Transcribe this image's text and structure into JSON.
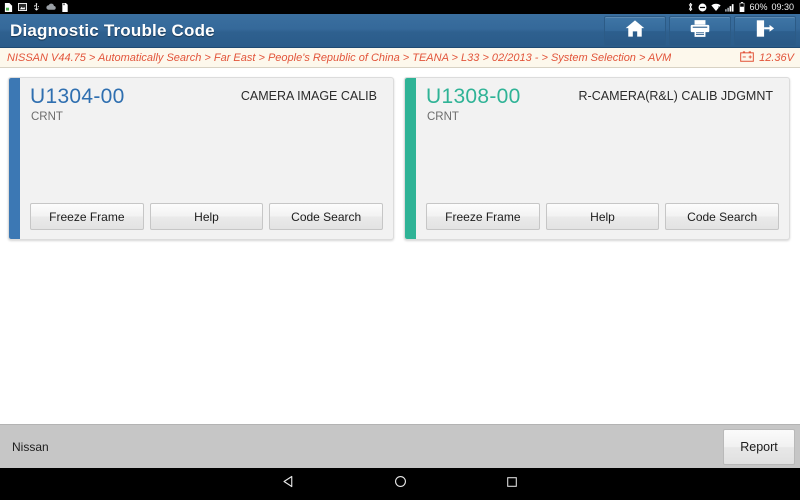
{
  "statusbar": {
    "left_icons": [
      "file-download-icon",
      "image-icon",
      "usb-icon",
      "cloud-icon",
      "sd-card-icon"
    ],
    "right_icons": [
      "bluetooth-icon",
      "do-not-disturb-icon",
      "wifi-icon",
      "cellular-signal-icon",
      "battery-icon"
    ],
    "battery_percent": "60%",
    "clock": "09:30"
  },
  "header": {
    "title": "Diagnostic Trouble Code",
    "buttons": [
      {
        "name": "home-button",
        "icon": "home-icon"
      },
      {
        "name": "print-button",
        "icon": "printer-icon"
      },
      {
        "name": "exit-button",
        "icon": "exit-icon"
      }
    ]
  },
  "breadcrumb": {
    "path": "NISSAN V44.75 > Automatically Search > Far East > People's Republic of China > TEANA > L33 > 02/2013 - > System Selection > AVM",
    "voltage": "12.36V",
    "voltage_icon": "battery-voltage-icon"
  },
  "main": {
    "cards": [
      {
        "code": "U1304-00",
        "status": "CRNT",
        "title": "CAMERA IMAGE CALIB",
        "accent": "#3c78b4",
        "buttons": [
          "Freeze Frame",
          "Help",
          "Code Search"
        ]
      },
      {
        "code": "U1308-00",
        "status": "CRNT",
        "title": "R-CAMERA(R&L) CALIB JDGMNT",
        "accent": "#2fb396",
        "buttons": [
          "Freeze Frame",
          "Help",
          "Code Search"
        ]
      }
    ]
  },
  "footer": {
    "vehicle": "Nissan",
    "report_label": "Report"
  },
  "navbar": {
    "keys": [
      "back-nav-key",
      "home-nav-key",
      "recents-nav-key"
    ]
  },
  "colors": {
    "accent_blue": "#3c78b4",
    "accent_green": "#2fb396",
    "titlebar_blue": "#35699a",
    "breadcrumb_text": "#e2543a"
  }
}
